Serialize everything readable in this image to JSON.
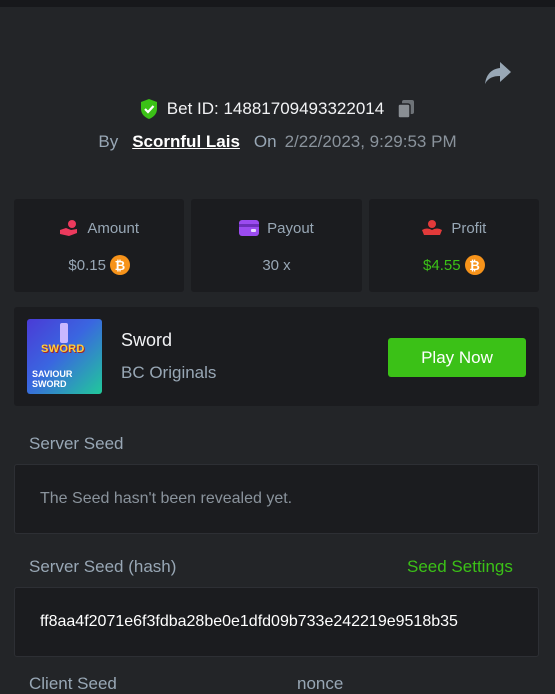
{
  "bet": {
    "id_label": "Bet ID: 14881709493322014",
    "by_label": "By",
    "user": "Scornful Lais",
    "on_label": "On",
    "date": "2/22/2023, 9:29:53 PM"
  },
  "stats": {
    "amount": {
      "label": "Amount",
      "value": "$0.15"
    },
    "payout": {
      "label": "Payout",
      "value": "30 x"
    },
    "profit": {
      "label": "Profit",
      "value": "$4.55"
    },
    "coin_symbol": "₿"
  },
  "game": {
    "name": "Sword",
    "provider": "BC Originals",
    "play_label": "Play Now",
    "thumb_title": "SWORD",
    "thumb_sub": "SAVIOUR SWORD"
  },
  "server_seed": {
    "label": "Server Seed",
    "value": "The Seed hasn't been revealed yet."
  },
  "server_seed_hash": {
    "label": "Server Seed (hash)",
    "settings_label": "Seed Settings",
    "value": "ff8aa4f2071e6f3fdba28be0e1dfd09b733e242219e9518b35"
  },
  "client_seed": {
    "label": "Client Seed",
    "nonce_label": "nonce"
  },
  "colors": {
    "background": "#232528",
    "panel": "#1b1c1f",
    "accent_green": "#3bc117",
    "muted_text": "#98a7b5",
    "bitcoin": "#f7931a"
  },
  "icons": {
    "share": "share-icon",
    "verified": "shield-check-icon",
    "copy": "copy-icon",
    "amount": "coins-hand-icon",
    "payout": "wallet-icon",
    "profit": "profit-hand-icon",
    "coin": "bitcoin-icon"
  }
}
